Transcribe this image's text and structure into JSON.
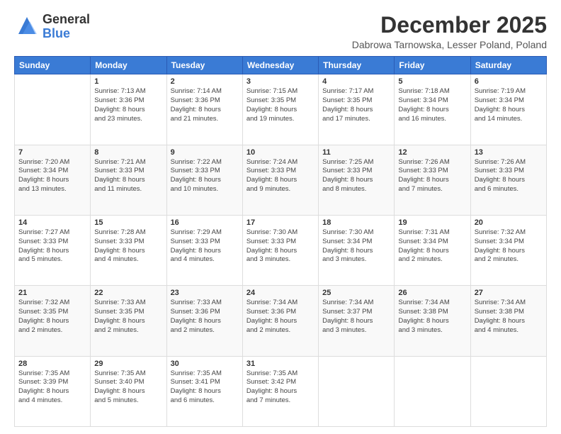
{
  "logo": {
    "general": "General",
    "blue": "Blue"
  },
  "title": "December 2025",
  "location": "Dabrowa Tarnowska, Lesser Poland, Poland",
  "days": [
    "Sunday",
    "Monday",
    "Tuesday",
    "Wednesday",
    "Thursday",
    "Friday",
    "Saturday"
  ],
  "weeks": [
    [
      {
        "num": "",
        "text": ""
      },
      {
        "num": "1",
        "text": "Sunrise: 7:13 AM\nSunset: 3:36 PM\nDaylight: 8 hours\nand 23 minutes."
      },
      {
        "num": "2",
        "text": "Sunrise: 7:14 AM\nSunset: 3:36 PM\nDaylight: 8 hours\nand 21 minutes."
      },
      {
        "num": "3",
        "text": "Sunrise: 7:15 AM\nSunset: 3:35 PM\nDaylight: 8 hours\nand 19 minutes."
      },
      {
        "num": "4",
        "text": "Sunrise: 7:17 AM\nSunset: 3:35 PM\nDaylight: 8 hours\nand 17 minutes."
      },
      {
        "num": "5",
        "text": "Sunrise: 7:18 AM\nSunset: 3:34 PM\nDaylight: 8 hours\nand 16 minutes."
      },
      {
        "num": "6",
        "text": "Sunrise: 7:19 AM\nSunset: 3:34 PM\nDaylight: 8 hours\nand 14 minutes."
      }
    ],
    [
      {
        "num": "7",
        "text": "Sunrise: 7:20 AM\nSunset: 3:34 PM\nDaylight: 8 hours\nand 13 minutes."
      },
      {
        "num": "8",
        "text": "Sunrise: 7:21 AM\nSunset: 3:33 PM\nDaylight: 8 hours\nand 11 minutes."
      },
      {
        "num": "9",
        "text": "Sunrise: 7:22 AM\nSunset: 3:33 PM\nDaylight: 8 hours\nand 10 minutes."
      },
      {
        "num": "10",
        "text": "Sunrise: 7:24 AM\nSunset: 3:33 PM\nDaylight: 8 hours\nand 9 minutes."
      },
      {
        "num": "11",
        "text": "Sunrise: 7:25 AM\nSunset: 3:33 PM\nDaylight: 8 hours\nand 8 minutes."
      },
      {
        "num": "12",
        "text": "Sunrise: 7:26 AM\nSunset: 3:33 PM\nDaylight: 8 hours\nand 7 minutes."
      },
      {
        "num": "13",
        "text": "Sunrise: 7:26 AM\nSunset: 3:33 PM\nDaylight: 8 hours\nand 6 minutes."
      }
    ],
    [
      {
        "num": "14",
        "text": "Sunrise: 7:27 AM\nSunset: 3:33 PM\nDaylight: 8 hours\nand 5 minutes."
      },
      {
        "num": "15",
        "text": "Sunrise: 7:28 AM\nSunset: 3:33 PM\nDaylight: 8 hours\nand 4 minutes."
      },
      {
        "num": "16",
        "text": "Sunrise: 7:29 AM\nSunset: 3:33 PM\nDaylight: 8 hours\nand 4 minutes."
      },
      {
        "num": "17",
        "text": "Sunrise: 7:30 AM\nSunset: 3:33 PM\nDaylight: 8 hours\nand 3 minutes."
      },
      {
        "num": "18",
        "text": "Sunrise: 7:30 AM\nSunset: 3:34 PM\nDaylight: 8 hours\nand 3 minutes."
      },
      {
        "num": "19",
        "text": "Sunrise: 7:31 AM\nSunset: 3:34 PM\nDaylight: 8 hours\nand 2 minutes."
      },
      {
        "num": "20",
        "text": "Sunrise: 7:32 AM\nSunset: 3:34 PM\nDaylight: 8 hours\nand 2 minutes."
      }
    ],
    [
      {
        "num": "21",
        "text": "Sunrise: 7:32 AM\nSunset: 3:35 PM\nDaylight: 8 hours\nand 2 minutes."
      },
      {
        "num": "22",
        "text": "Sunrise: 7:33 AM\nSunset: 3:35 PM\nDaylight: 8 hours\nand 2 minutes."
      },
      {
        "num": "23",
        "text": "Sunrise: 7:33 AM\nSunset: 3:36 PM\nDaylight: 8 hours\nand 2 minutes."
      },
      {
        "num": "24",
        "text": "Sunrise: 7:34 AM\nSunset: 3:36 PM\nDaylight: 8 hours\nand 2 minutes."
      },
      {
        "num": "25",
        "text": "Sunrise: 7:34 AM\nSunset: 3:37 PM\nDaylight: 8 hours\nand 3 minutes."
      },
      {
        "num": "26",
        "text": "Sunrise: 7:34 AM\nSunset: 3:38 PM\nDaylight: 8 hours\nand 3 minutes."
      },
      {
        "num": "27",
        "text": "Sunrise: 7:34 AM\nSunset: 3:38 PM\nDaylight: 8 hours\nand 4 minutes."
      }
    ],
    [
      {
        "num": "28",
        "text": "Sunrise: 7:35 AM\nSunset: 3:39 PM\nDaylight: 8 hours\nand 4 minutes."
      },
      {
        "num": "29",
        "text": "Sunrise: 7:35 AM\nSunset: 3:40 PM\nDaylight: 8 hours\nand 5 minutes."
      },
      {
        "num": "30",
        "text": "Sunrise: 7:35 AM\nSunset: 3:41 PM\nDaylight: 8 hours\nand 6 minutes."
      },
      {
        "num": "31",
        "text": "Sunrise: 7:35 AM\nSunset: 3:42 PM\nDaylight: 8 hours\nand 7 minutes."
      },
      {
        "num": "",
        "text": ""
      },
      {
        "num": "",
        "text": ""
      },
      {
        "num": "",
        "text": ""
      }
    ]
  ]
}
